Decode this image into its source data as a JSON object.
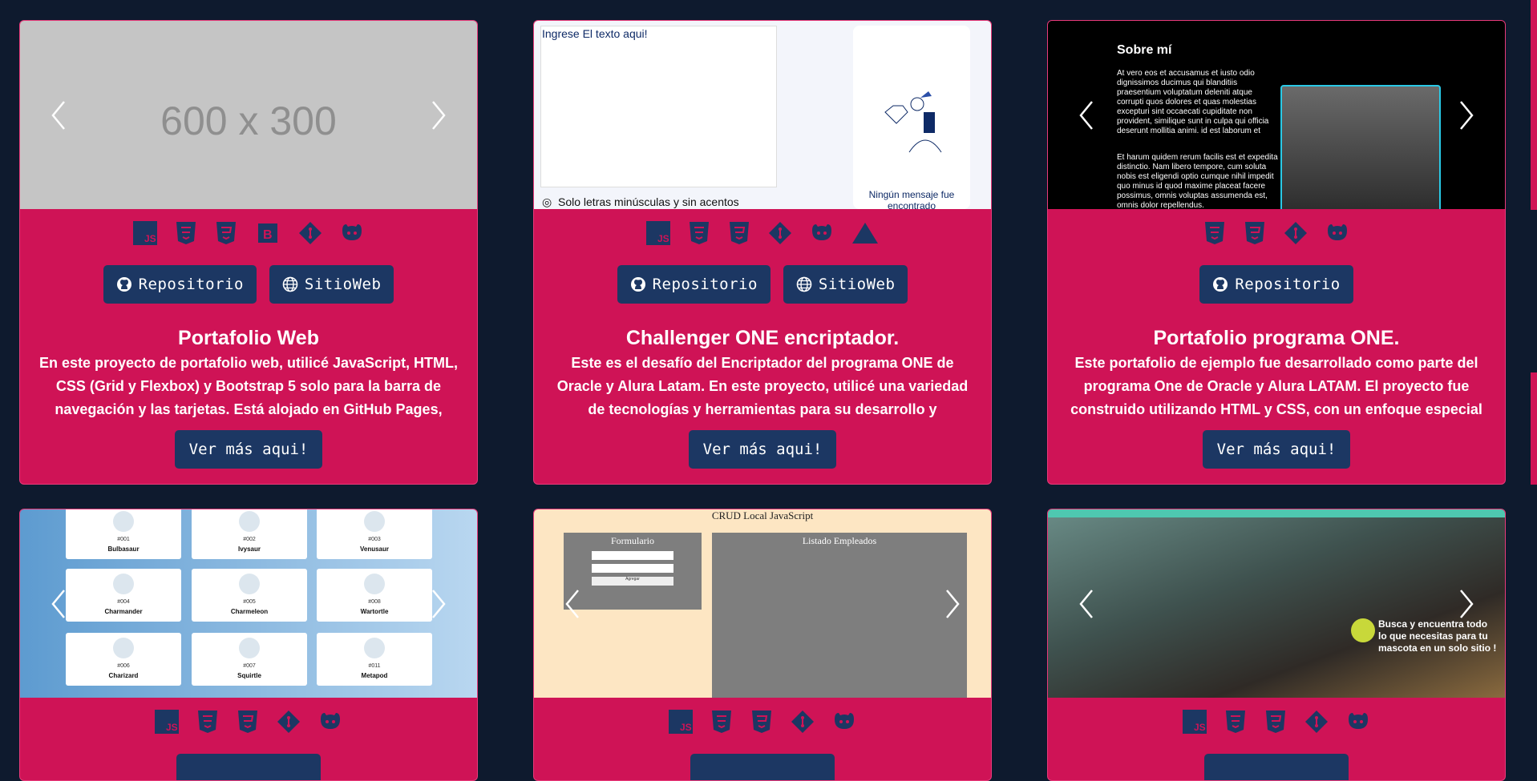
{
  "colors": {
    "page_bg": "#0e1a2e",
    "card_bg": "#cf1356",
    "button_bg": "#1c3763",
    "icon_color": "#1c3763"
  },
  "cards": [
    {
      "image_text": "600 x 300",
      "icons": [
        "js-icon",
        "html5-icon",
        "css3-icon",
        "bootstrap-icon",
        "git-icon",
        "github-icon"
      ],
      "buttons": [
        "Repositorio",
        "SitioWeb"
      ],
      "title": "Portafolio Web",
      "description": "En este proyecto de portafolio web, utilicé JavaScript, HTML, CSS (Grid y Flexbox) y Bootstrap 5 solo para la barra de navegación y las tarjetas. Está alojado en GitHub Pages,",
      "more": "Ver más aqui!"
    },
    {
      "image_placeholder": "Ingrese El texto aqui!",
      "image_note": "Solo letras minúsculas y sin acentos",
      "image_message": "Ningún mensaje fue encontrado",
      "icons": [
        "js-icon",
        "html5-icon",
        "css3-icon",
        "git-icon",
        "github-icon",
        "vercel-icon"
      ],
      "buttons": [
        "Repositorio",
        "SitioWeb"
      ],
      "title": "Challenger ONE encriptador.",
      "description": "Este es el desafío del Encriptador del programa ONE de Oracle y Alura Latam. En este proyecto, utilicé una variedad de tecnologías y herramientas para su desarrollo y despliegue:",
      "more": "Ver más aqui!"
    },
    {
      "image_heading": "Sobre mí",
      "image_p1": "At vero eos et accusamus et iusto odio dignissimos ducimus qui blanditiis praesentium voluptatum deleniti atque corrupti quos dolores et quas molestias excepturi sint occaecati cupiditate non provident, similique sunt in culpa qui officia deserunt mollitia animi, id est laborum et dolorum fuga.",
      "image_p2": "Et harum quidem rerum facilis est et expedita distinctio. Nam libero tempore, cum soluta nobis est eligendi optio cumque nihil impedit quo minus id quod maxime placeat facere possimus, omnis voluptas assumenda est, omnis dolor repellendus.",
      "icons": [
        "html5-icon",
        "css3-icon",
        "git-icon",
        "github-icon"
      ],
      "buttons": [
        "Repositorio"
      ],
      "title": "Portafolio programa ONE.",
      "description": "Este portafolio de ejemplo fue desarrollado como parte del programa One de Oracle y Alura LATAM. El proyecto fue construido utilizando HTML y CSS, con un enfoque especial en",
      "more": "Ver más aqui!"
    },
    {
      "pokemon": [
        {
          "num": "#001",
          "name": "Bulbasaur"
        },
        {
          "num": "#002",
          "name": "Ivysaur"
        },
        {
          "num": "#003",
          "name": "Venusaur"
        },
        {
          "num": "#004",
          "name": "Charmander"
        },
        {
          "num": "#005",
          "name": "Charmeleon"
        },
        {
          "num": "#008",
          "name": "Wartortle"
        },
        {
          "num": "#006",
          "name": "Charizard"
        },
        {
          "num": "#007",
          "name": "Squirtle"
        },
        {
          "num": "#011",
          "name": "Metapod"
        }
      ],
      "icons": [
        "js-icon",
        "html5-icon",
        "css3-icon",
        "git-icon",
        "github-icon"
      ]
    },
    {
      "image_title": "CRUD Local JavaScript",
      "form_label": "Formulario",
      "list_label": "Listado Empleados",
      "submit_label": "Agregar",
      "icons": [
        "js-icon",
        "html5-icon",
        "css3-icon",
        "git-icon",
        "github-icon"
      ]
    },
    {
      "image_text": "Busca y encuentra todo lo que necesitas para tu mascota en un solo sitio !",
      "icons": [
        "js-icon",
        "html5-icon",
        "css3-icon",
        "git-icon",
        "github-icon"
      ]
    }
  ]
}
